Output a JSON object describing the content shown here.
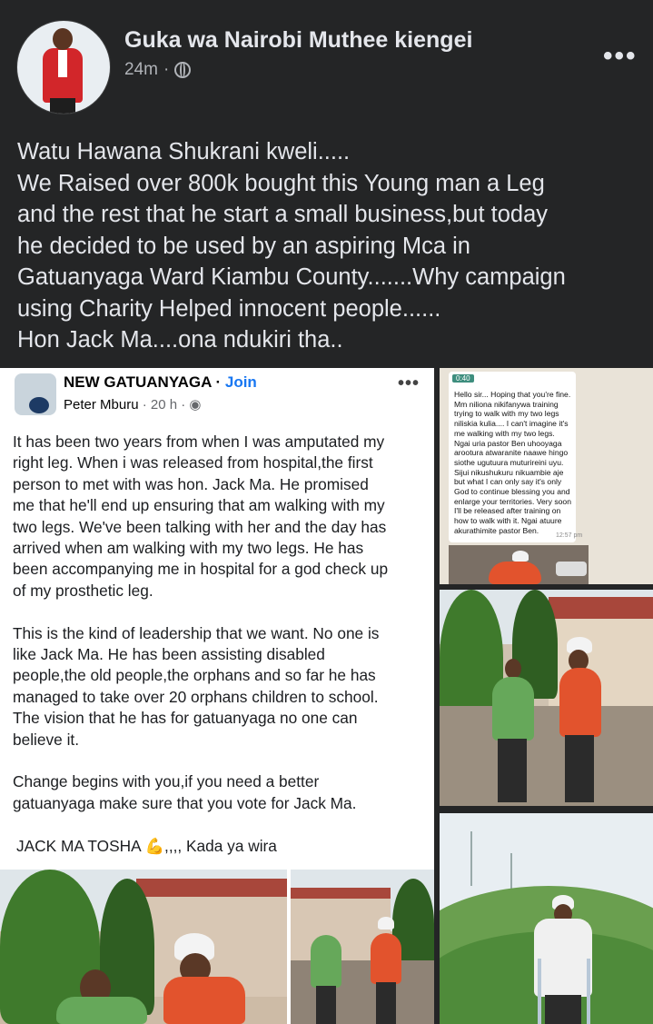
{
  "post": {
    "author": "Guka wa Nairobi Muthee kiengei",
    "time": "24m",
    "dot": "·",
    "more": "•••",
    "lines": [
      "Watu Hawana Shukrani kweli.....",
      "We Raised over 800k bought this Young man a Leg",
      "and the rest that he start a small business,but today",
      "he decided to be used by an aspiring Mca in",
      "Gatuanyaga Ward Kiambu County.......Why campaign",
      "using Charity Helped innocent people......",
      "Hon Jack Ma....ona ndukiri tha.."
    ]
  },
  "screenshot": {
    "group": "NEW GATUANYAGA",
    "separator": " · ",
    "join": "Join",
    "author": "Peter Mburu",
    "time": " · 20 h · ",
    "more": "•••",
    "para1": [
      "It has been two years from when I was amputated my",
      "right leg. When i was released from hospital,the first",
      "person to met with was hon. Jack Ma. He promised",
      "me that he'll end up ensuring that am walking with my",
      "two legs. We've been talking with her and the day has",
      "arrived when am walking with my two legs. He has",
      "been accompanying me in hospital for a god check up",
      "of my prosthetic leg."
    ],
    "para2": [
      " This is the kind of leadership that we want. No one is",
      "like Jack Ma. He has been assisting disabled",
      "people,the old people,the orphans and so far he has",
      "managed to take over 20 orphans children to school.",
      "The vision that he has for gatuanyaga no one can",
      "believe it."
    ],
    "para3": [
      "Change begins with you,if you need a better",
      "gatuanyaga make sure that you vote for Jack Ma."
    ],
    "tagline": "JACK MA TOSHA 💪,,,, Kada ya wira"
  },
  "whatsapp": {
    "header": "0:40",
    "lines": [
      "Hello sir... Hoping that you're fine.",
      "Mm niliona nikifanywa training",
      "trying to walk with my two legs",
      "niliskia kulia.... I can't imagine it's",
      "me walking with my two legs.",
      "Ngai uria pastor Ben uhooyaga",
      "arootura atwaranite naawe hingo",
      "siothe ugutuura muturireini uyu.",
      "Sijui nikushukuru nikuambie aje",
      "but what I can only say it's only",
      "God to continue blessing you and",
      "enlarge your territories. Very soon",
      "I'll be released after training on",
      "how to walk with it. Ngai atuure",
      "akurathimite pastor Ben."
    ],
    "time": "12:57 pm"
  }
}
